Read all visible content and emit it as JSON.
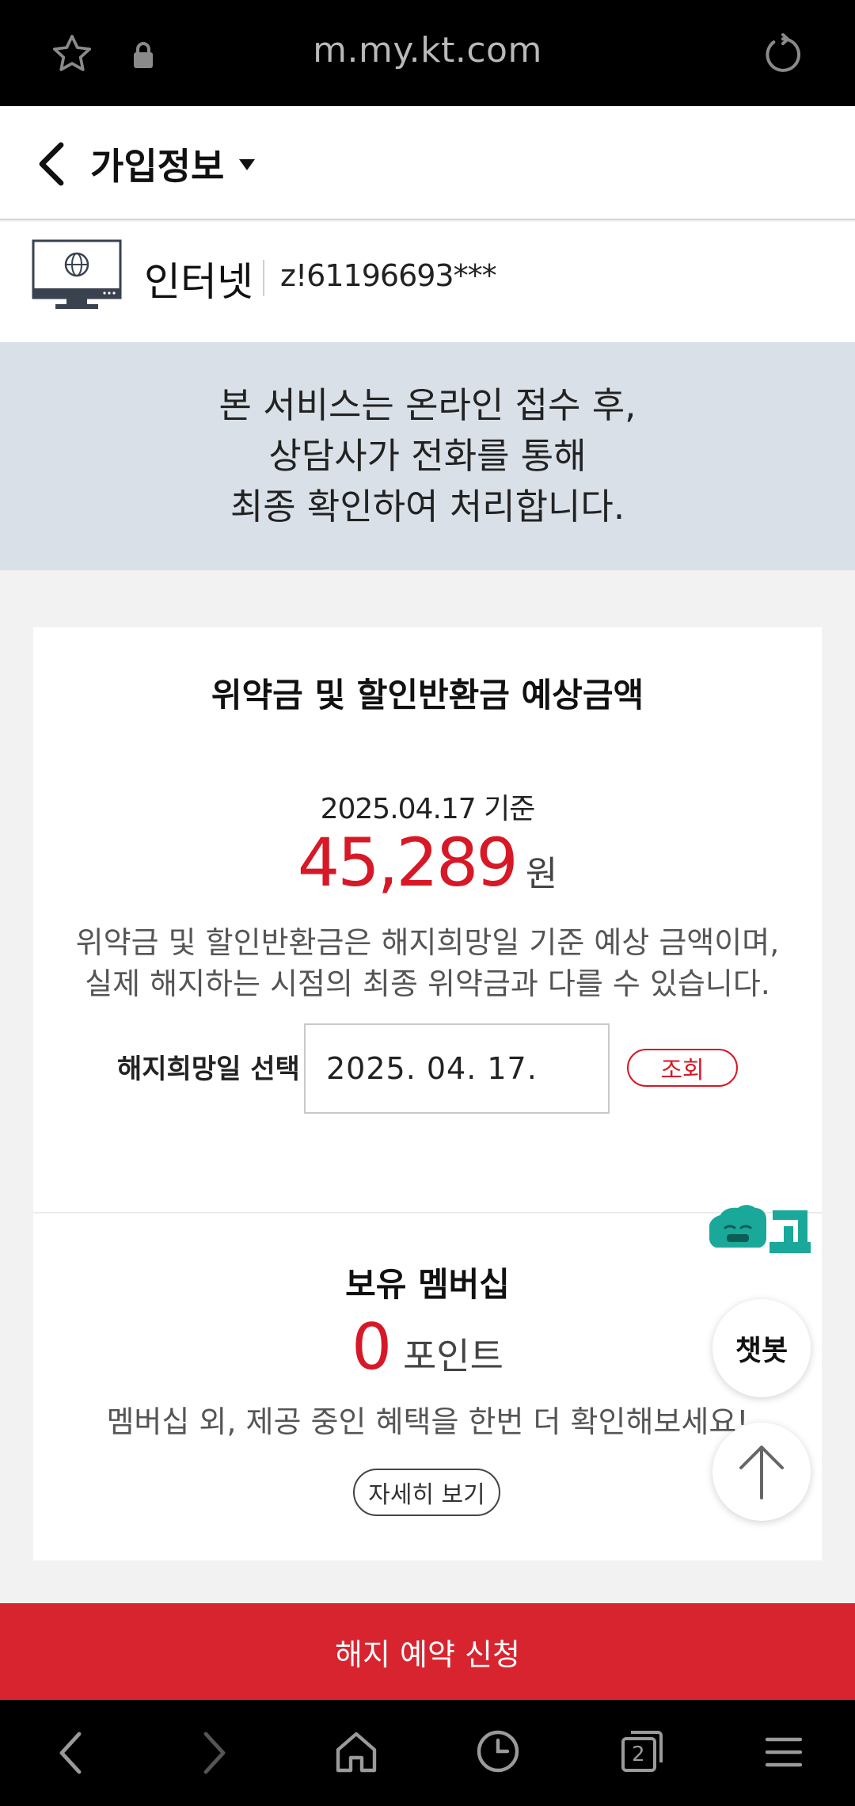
{
  "browser": {
    "url": "m.my.kt.com"
  },
  "header": {
    "title": "가입정보"
  },
  "service": {
    "name": "인터넷",
    "account": "z!61196693***"
  },
  "notice": {
    "lines": [
      "본 서비스는 온라인 접수 후,",
      "상담사가 전화를 통해",
      "최종 확인하여 처리합니다."
    ]
  },
  "penalty": {
    "title": "위약금 및 할인반환금 예상금액",
    "date_line": "2025.04.17 기준",
    "amount": "45,289",
    "unit": "원",
    "description": "위약금 및 할인반환금은 해지희망일 기준 예상 금액이며, 실제 해지하는 시점의 최종 위약금과 다를 수 있습니다.",
    "date_label": "해지희망일 선택",
    "date_value": "2025. 04. 17.",
    "query_label": "조회"
  },
  "membership": {
    "title": "보유 멤버십",
    "points": "0",
    "points_unit": "포인트",
    "benefit_text": "멤버십 외, 제공 중인 혜택을 한번 더 확인해보세요!",
    "detail_label": "자세히 보기"
  },
  "floating": {
    "chatbot_label": "챗봇"
  },
  "cta": {
    "label": "해지 예약 신청"
  },
  "tabs": {
    "count": "2"
  },
  "colors": {
    "accent": "#d71826",
    "teal": "#1aa89a"
  }
}
